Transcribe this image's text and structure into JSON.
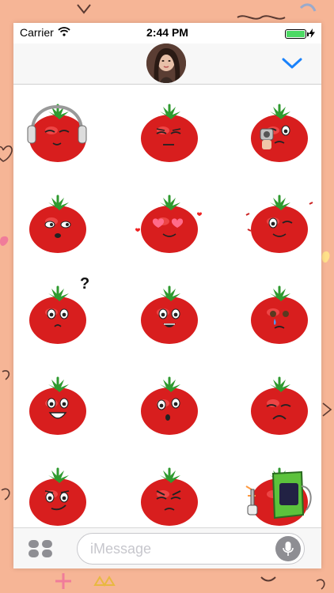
{
  "status_bar": {
    "carrier": "Carrier",
    "time": "2:44 PM",
    "battery_level": 1.0
  },
  "header": {
    "avatar_icon": "contact-avatar-photo",
    "expand_icon": "chevron-down-icon"
  },
  "stickers": [
    {
      "name": "tomato-headphones-sticker",
      "icon": "tomato-headphones"
    },
    {
      "name": "tomato-neutral-sticker",
      "icon": "tomato-neutral"
    },
    {
      "name": "tomato-gun-sticker",
      "icon": "tomato-gun"
    },
    {
      "name": "tomato-side-eye-sticker",
      "icon": "tomato-side-eye"
    },
    {
      "name": "tomato-heart-eyes-sticker",
      "icon": "tomato-heart-eyes"
    },
    {
      "name": "tomato-wink-sticker",
      "icon": "tomato-wink"
    },
    {
      "name": "tomato-thinking-sticker",
      "icon": "tomato-thinking"
    },
    {
      "name": "tomato-grin-sticker",
      "icon": "tomato-grin"
    },
    {
      "name": "tomato-crying-sticker",
      "icon": "tomato-crying"
    },
    {
      "name": "tomato-happy-sticker",
      "icon": "tomato-happy"
    },
    {
      "name": "tomato-confused-sticker",
      "icon": "tomato-confused"
    },
    {
      "name": "tomato-sad-sticker",
      "icon": "tomato-sad"
    },
    {
      "name": "tomato-smirk-sticker",
      "icon": "tomato-smirk"
    },
    {
      "name": "tomato-angry-sticker",
      "icon": "tomato-angry"
    },
    {
      "name": "tomato-welder-sticker",
      "icon": "tomato-welder"
    }
  ],
  "composer": {
    "placeholder": "iMessage",
    "apps_icon": "app-drawer-icon",
    "mic_icon": "microphone-icon"
  },
  "colors": {
    "background": "#f6b596",
    "tomato": "#d81e1e",
    "leaf": "#2f9a2f",
    "accent": "#1a82fb"
  }
}
